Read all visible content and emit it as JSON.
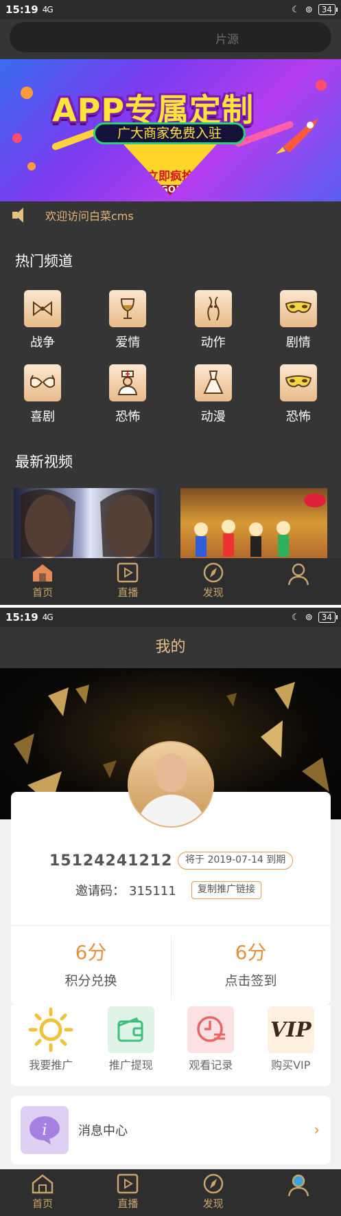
{
  "status_bar": {
    "time": "15:19",
    "signal": "4G",
    "battery": "34"
  },
  "home": {
    "search": {
      "placeholder": "片源"
    },
    "banner": {
      "headline": "APP专属定制",
      "pill_text": "广大商家免费入驻",
      "cta": "立即疯抢",
      "go": "GO!"
    },
    "notice": "欢迎访问白菜cms",
    "hot_channels": {
      "title": "热门频道",
      "items": [
        {
          "label": "战争",
          "icon": "bow-tie-icon"
        },
        {
          "label": "爱情",
          "icon": "wine-glass-icon"
        },
        {
          "label": "动作",
          "icon": "body-figure-icon"
        },
        {
          "label": "剧情",
          "icon": "eye-mask-icon"
        },
        {
          "label": "喜剧",
          "icon": "bra-icon"
        },
        {
          "label": "恐怖",
          "icon": "nurse-icon"
        },
        {
          "label": "动漫",
          "icon": "dress-icon"
        },
        {
          "label": "恐怖",
          "icon": "eye-mask-icon"
        }
      ]
    },
    "latest_videos": {
      "title": "最新视频"
    },
    "tabbar": [
      {
        "label": "首页",
        "icon": "home-icon"
      },
      {
        "label": "直播",
        "icon": "play-icon"
      },
      {
        "label": "发现",
        "icon": "compass-icon"
      },
      {
        "label": "",
        "icon": "user-icon"
      }
    ]
  },
  "profile": {
    "title": "我的",
    "phone": "15124241212",
    "expire": "将于 2019-07-14 到期",
    "invite_label": "邀请码：",
    "invite_code": "315111",
    "copy_link": "复制推广链接",
    "points": {
      "value": "6分",
      "label": "积分兑换"
    },
    "checkin": {
      "value": "6分",
      "label": "点击签到"
    },
    "actions": [
      {
        "label": "我要推广",
        "icon": "sun-icon"
      },
      {
        "label": "推广提现",
        "icon": "wallet-icon"
      },
      {
        "label": "观看记录",
        "icon": "clock-list-icon"
      },
      {
        "label": "购买VIP",
        "icon": "vip-icon"
      }
    ],
    "vip_text": "VIP",
    "message_center": "消息中心",
    "tabbar": [
      {
        "label": "首页",
        "icon": "home-icon"
      },
      {
        "label": "直播",
        "icon": "play-icon"
      },
      {
        "label": "发现",
        "icon": "compass-icon"
      },
      {
        "label": "",
        "icon": "user-icon"
      }
    ]
  },
  "colors": {
    "accent": "#e5903f",
    "gold": "#c9a56e",
    "dark_bg": "#353535"
  }
}
